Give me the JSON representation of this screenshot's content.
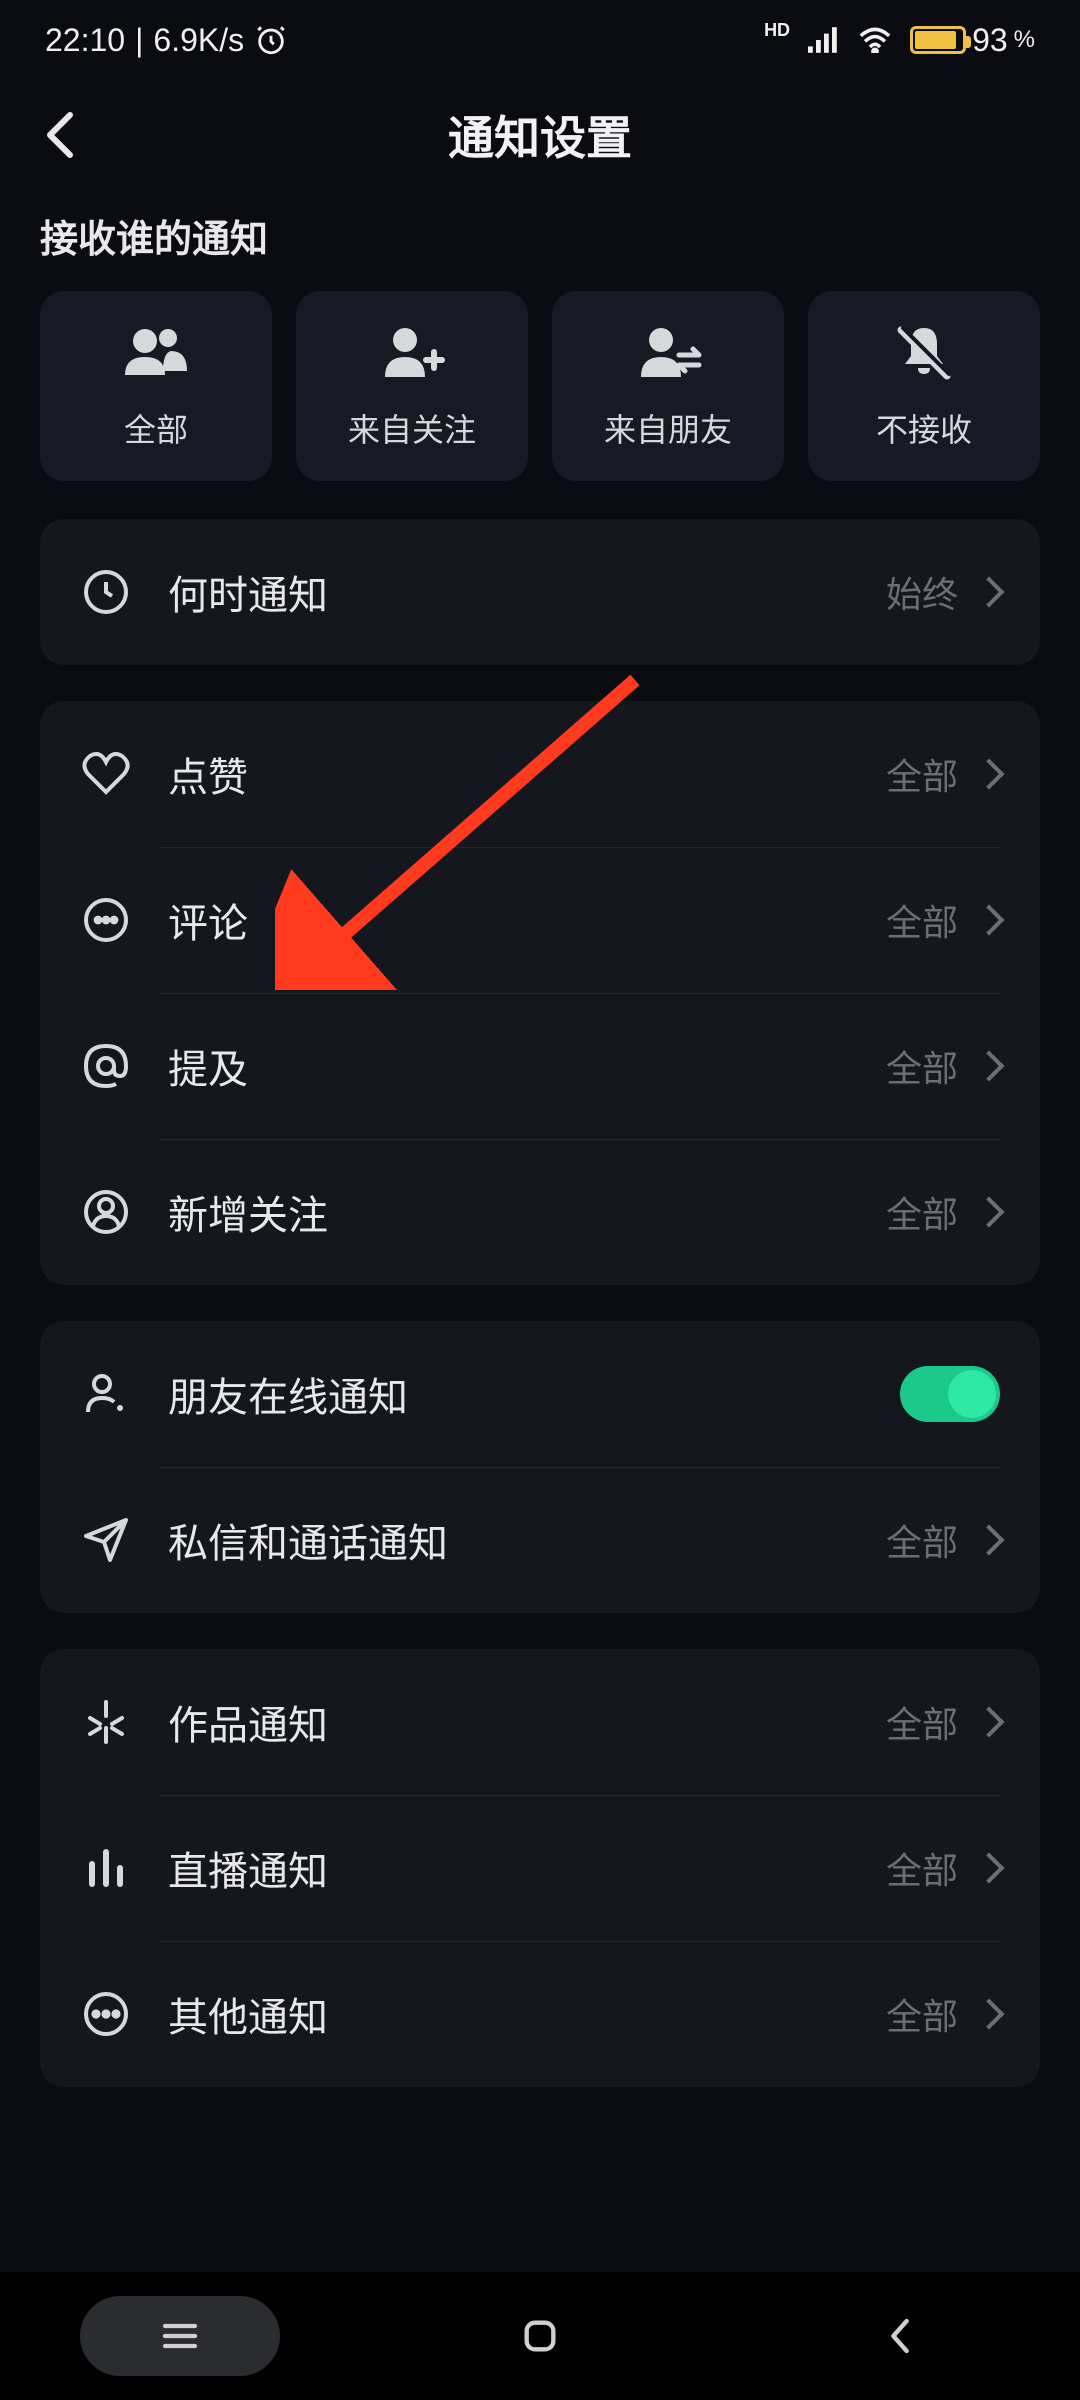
{
  "status": {
    "time": "22:10",
    "speed": "6.9K/s",
    "battery_pct": "93",
    "battery_suffix": "%"
  },
  "header": {
    "title": "通知设置"
  },
  "section_label": "接收谁的通知",
  "filters": {
    "all": "全部",
    "following": "来自关注",
    "friends": "来自朋友",
    "none": "不接收"
  },
  "rows": {
    "when": {
      "label": "何时通知",
      "value": "始终"
    },
    "like": {
      "label": "点赞",
      "value": "全部"
    },
    "comment": {
      "label": "评论",
      "value": "全部"
    },
    "mention": {
      "label": "提及",
      "value": "全部"
    },
    "new_follow": {
      "label": "新增关注",
      "value": "全部"
    },
    "friend_online": {
      "label": "朋友在线通知"
    },
    "dm_call": {
      "label": "私信和通话通知",
      "value": "全部"
    },
    "works": {
      "label": "作品通知",
      "value": "全部"
    },
    "live": {
      "label": "直播通知",
      "value": "全部"
    },
    "other": {
      "label": "其他通知",
      "value": "全部"
    }
  }
}
